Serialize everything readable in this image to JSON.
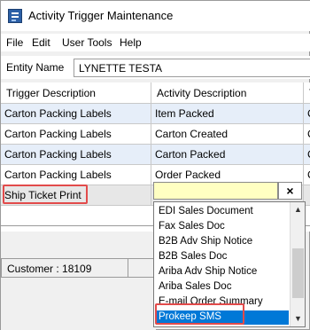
{
  "window": {
    "title": "Activity Trigger Maintenance"
  },
  "menu": {
    "items": [
      "File",
      "Edit",
      "User Tools",
      "Help"
    ]
  },
  "entity": {
    "label": "Entity Name",
    "value": "LYNETTE TESTA"
  },
  "grid": {
    "columns": [
      "Trigger Description",
      "Activity Description",
      "T"
    ],
    "rows": [
      {
        "trigger": "Carton Packing Labels",
        "activity": "Item Packed",
        "extra": "C"
      },
      {
        "trigger": "Carton Packing Labels",
        "activity": "Carton Created",
        "extra": "C"
      },
      {
        "trigger": "Carton Packing Labels",
        "activity": "Carton Packed",
        "extra": "C"
      },
      {
        "trigger": "Carton Packing Labels",
        "activity": "Order Packed",
        "extra": "C"
      },
      {
        "trigger": "Ship Ticket Print",
        "activity": "",
        "extra": ""
      }
    ]
  },
  "editor": {
    "clear_label": "×",
    "value": ""
  },
  "footer": {
    "customer_text": "Customer : 18109"
  },
  "dropdown": {
    "options": [
      "EDI Sales Document",
      "Fax Sales Doc",
      "B2B Adv Ship Notice",
      "B2B Sales Doc",
      "Ariba Adv Ship Notice",
      "Ariba Sales Doc",
      "E-mail Order Summary",
      "Prokeep SMS"
    ],
    "selected": "Prokeep SMS",
    "scroll_up_glyph": "▲",
    "scroll_down_glyph": "▼"
  },
  "colors": {
    "highlight": "#e24b4b",
    "selection": "#0078d7",
    "edit_background": "#ffffc2",
    "row_tint": "#e6eef9"
  }
}
